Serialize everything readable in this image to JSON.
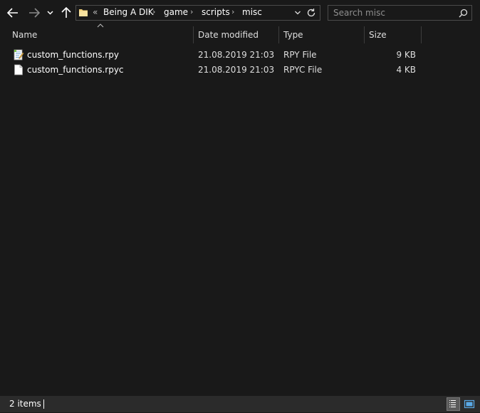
{
  "toolbar": {
    "back_icon": "arrow-left-icon",
    "forward_icon": "arrow-right-icon",
    "recent_icon": "chevron-down-icon",
    "up_icon": "arrow-up-icon"
  },
  "address": {
    "overflow": "«",
    "crumbs": [
      "Being A DIK",
      "game",
      "scripts",
      "misc"
    ]
  },
  "search": {
    "placeholder": "Search misc"
  },
  "columns": {
    "name": "Name",
    "date": "Date modified",
    "type": "Type",
    "size": "Size"
  },
  "files": [
    {
      "name": "custom_functions.rpy",
      "date": "21.08.2019 21:03",
      "type": "RPY File",
      "size": "9 KB",
      "icon": "script-file-icon"
    },
    {
      "name": "custom_functions.rpyc",
      "date": "21.08.2019 21:03",
      "type": "RPYC File",
      "size": "4 KB",
      "icon": "blank-file-icon"
    }
  ],
  "status": {
    "items": "2 items"
  },
  "colors": {
    "background": "#191919",
    "statusbar": "#2b2b2b",
    "folder": "#f3d27a"
  }
}
